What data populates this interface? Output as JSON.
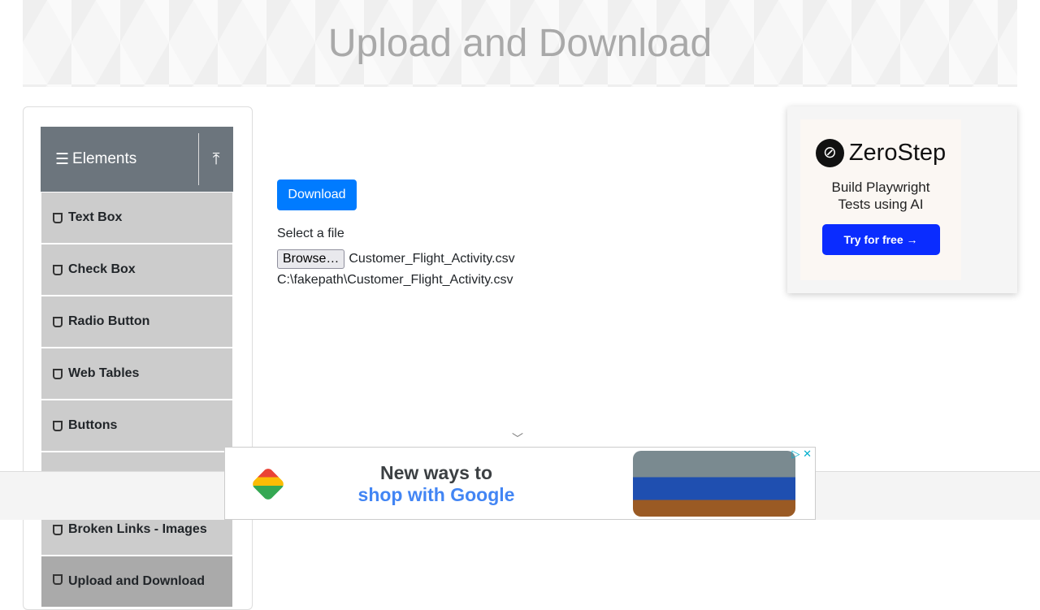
{
  "header": {
    "title": "Upload and Download"
  },
  "sidebar": {
    "group_title": "Elements",
    "items": [
      {
        "label": "Text Box"
      },
      {
        "label": "Check Box"
      },
      {
        "label": "Radio Button"
      },
      {
        "label": "Web Tables"
      },
      {
        "label": "Buttons"
      },
      {
        "label": ""
      },
      {
        "label": "Broken Links - Images"
      },
      {
        "label": "Upload and Download"
      }
    ]
  },
  "main": {
    "download_label": "Download",
    "select_label": "Select a file",
    "browse_label": "Browse…",
    "file_name": "Customer_Flight_Activity.csv",
    "uploaded_path": "C:\\fakepath\\Customer_Flight_Activity.csv"
  },
  "side_ad": {
    "brand": "ZeroStep",
    "tagline_1": "Build Playwright",
    "tagline_2": "Tests using AI",
    "cta": "Try for free →",
    "cta_color": "#0a2cff"
  },
  "bottom_ad": {
    "line1": "New ways to",
    "line2": "shop with Google",
    "close": "▷ ✕"
  },
  "colors": {
    "primary": "#007bff",
    "sidebar_header": "#6c757d"
  }
}
